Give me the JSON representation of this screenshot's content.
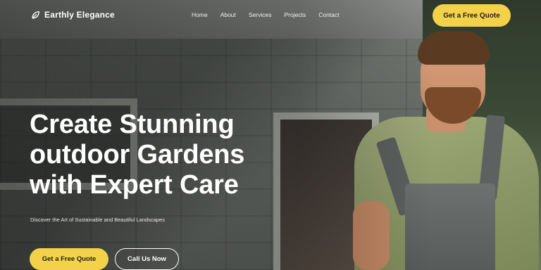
{
  "brand": {
    "name": "Earthly Elegance",
    "icon": "leaf-icon"
  },
  "nav": {
    "links": [
      {
        "label": "Home"
      },
      {
        "label": "About"
      },
      {
        "label": "Services"
      },
      {
        "label": "Projects"
      },
      {
        "label": "Contact"
      }
    ],
    "cta_label": "Get a Free Quote"
  },
  "hero": {
    "headline_lines": [
      "Create Stunning",
      "outdoor Gardens",
      "with Expert Care"
    ],
    "subtitle": "Discover the Art of Sustainable and Beautiful Landscapes",
    "primary_button": "Get a Free Quote",
    "secondary_button": "Call Us Now"
  },
  "colors": {
    "accent": "#f3d24a",
    "text_light": "#ffffff"
  }
}
